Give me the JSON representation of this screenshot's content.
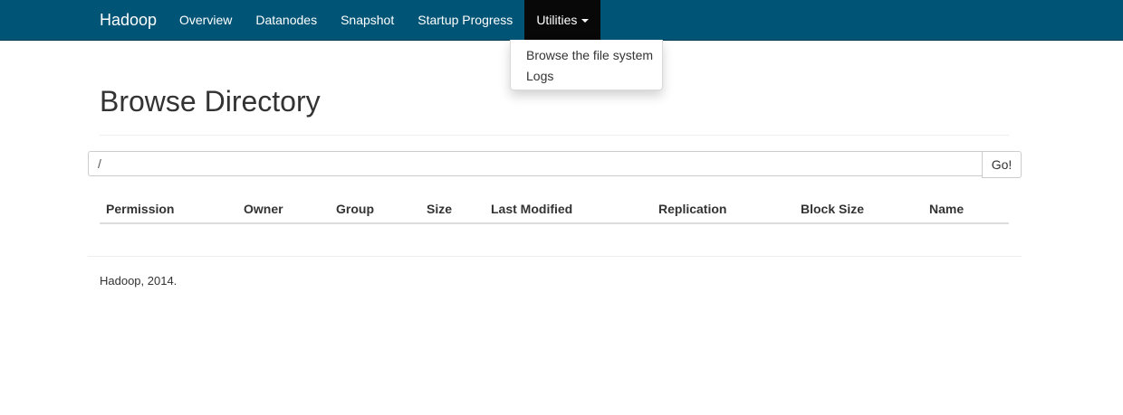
{
  "navbar": {
    "brand": "Hadoop",
    "links": [
      {
        "label": "Overview"
      },
      {
        "label": "Datanodes"
      },
      {
        "label": "Snapshot"
      },
      {
        "label": "Startup Progress"
      },
      {
        "label": "Utilities",
        "active": true
      }
    ],
    "dropdown": {
      "items": [
        {
          "label": "Browse the file system"
        },
        {
          "label": "Logs"
        }
      ]
    }
  },
  "main": {
    "title": "Browse Directory",
    "path_input": {
      "value": "/"
    },
    "go_button": "Go!",
    "table": {
      "columns": [
        "Permission",
        "Owner",
        "Group",
        "Size",
        "Last Modified",
        "Replication",
        "Block Size",
        "Name"
      ],
      "rows": []
    }
  },
  "footer": {
    "text": "Hadoop, 2014."
  },
  "colors": {
    "navbar_bg": "#005577",
    "active_tab_bg": "#080808"
  },
  "icons": {
    "dropdown_caret": "caret-down-icon"
  }
}
